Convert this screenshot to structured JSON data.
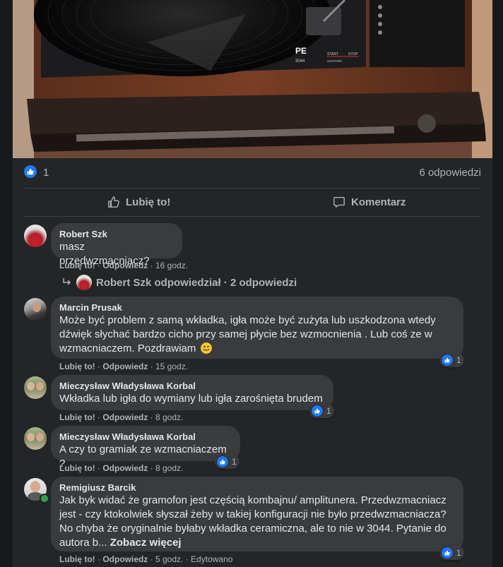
{
  "post": {
    "like_count": "1",
    "replies_count": "6 odpowiedzi",
    "like_action": "Lubię to!",
    "comment_action": "Komentarz"
  },
  "comments": [
    {
      "author": "Robert Szk",
      "text": "masz przedwzmacniacz?",
      "like": "Lubię to!",
      "reply": "Odpowiedz",
      "time": "16 godz."
    },
    {
      "author": "Marcin Prusak",
      "text": "Może być problem z samą wkładka, igła może być zużyta lub uszkodzona wtedy dźwięk słychać bardzo cicho przy samej płycie bez wzmocnienia . Lub coś ze w wzmacniaczem. Pozdrawiam",
      "like": "Lubię to!",
      "reply": "Odpowiedz",
      "time": "15 godz.",
      "reactions": "1"
    },
    {
      "author": "Mieczysław Władysława Korbal",
      "text": "Wkładka lub igła do wymiany lub igła zarośnięta brudem",
      "like": "Lubię to!",
      "reply": "Odpowiedz",
      "time": "8 godz.",
      "reactions": "1"
    },
    {
      "author": "Mieczysław Władysława Korbal",
      "text": "A czy to gramiak ze wzmacniaczem ?",
      "like": "Lubię to!",
      "reply": "Odpowiedz",
      "time": "8 godz.",
      "reactions": "1"
    },
    {
      "author": "Remigiusz Barcik",
      "text": "Jak byk widać że gramofon jest częścią kombajnu/ amplitunera. Przedwzmacniacz jest - czy ktokolwiek słyszał żeby w takiej konfiguracji nie było przedwzmacniacza? No chyba że oryginalnie byłaby wkładka ceramiczna, ale to nie w 3044. Pytanie do autora b...",
      "see_more": "Zobacz więcej",
      "like": "Lubię to!",
      "reply": "Odpowiedz",
      "time": "5 godz.",
      "edited": "Edytowano",
      "reactions": "1"
    }
  ],
  "replies_thread": {
    "label": "Robert Szk odpowiedział · 2 odpowiedzi"
  },
  "photo": {
    "brand": "PE",
    "model": "3044",
    "start": "START",
    "stop": "STOP",
    "automatic": "automatic"
  },
  "colors": {
    "background": "#18191a",
    "card": "#242526",
    "bubble": "#3a3b3c",
    "like_blue": "#2078f4",
    "text": "#e4e6eb",
    "muted": "#b0b3b8"
  }
}
